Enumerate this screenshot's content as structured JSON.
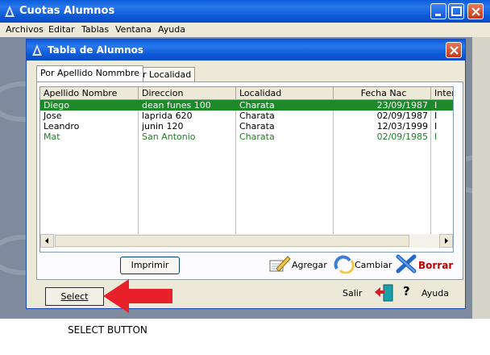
{
  "main_window": {
    "title": "Cuotas Alumnos",
    "menu": [
      "Archivos",
      "Editar",
      "Tablas",
      "Ventana",
      "Ayuda"
    ]
  },
  "dialog": {
    "title": "Tabla de Alumnos",
    "tabs": [
      "Por Apellido Nommbre",
      "Por Localidad"
    ],
    "columns": [
      "Apellido Nombre",
      "Direccion",
      "Localidad",
      "Fecha Nac",
      "Inter"
    ],
    "rows": [
      {
        "apellido": "Diego",
        "direccion": "dean funes 100",
        "localidad": "Charata",
        "fecha": "23/09/1987",
        "inter": "I"
      },
      {
        "apellido": "Jose",
        "direccion": "laprida 620",
        "localidad": "Charata",
        "fecha": "02/09/1987",
        "inter": "I"
      },
      {
        "apellido": "Leandro",
        "direccion": "junin 120",
        "localidad": "Charata",
        "fecha": "12/03/1999",
        "inter": "I"
      },
      {
        "apellido": "Mat",
        "direccion": "San Antonio",
        "localidad": "Charata",
        "fecha": "02/09/1985",
        "inter": "I"
      }
    ],
    "buttons": {
      "imprimir": "Imprimir",
      "agregar": "Agregar",
      "cambiar": "Cambiar",
      "borrar": "Borrar",
      "select": "Select",
      "salir": "Salir",
      "ayuda": "Ayuda"
    }
  },
  "annotation": {
    "caption": "SELECT BUTTON",
    "arrow_color": "#e8202a"
  },
  "colors": {
    "selected_row": "#1d8a2a",
    "green_row_text": "#1d7f22",
    "titlebar": "#0a5bd8"
  }
}
